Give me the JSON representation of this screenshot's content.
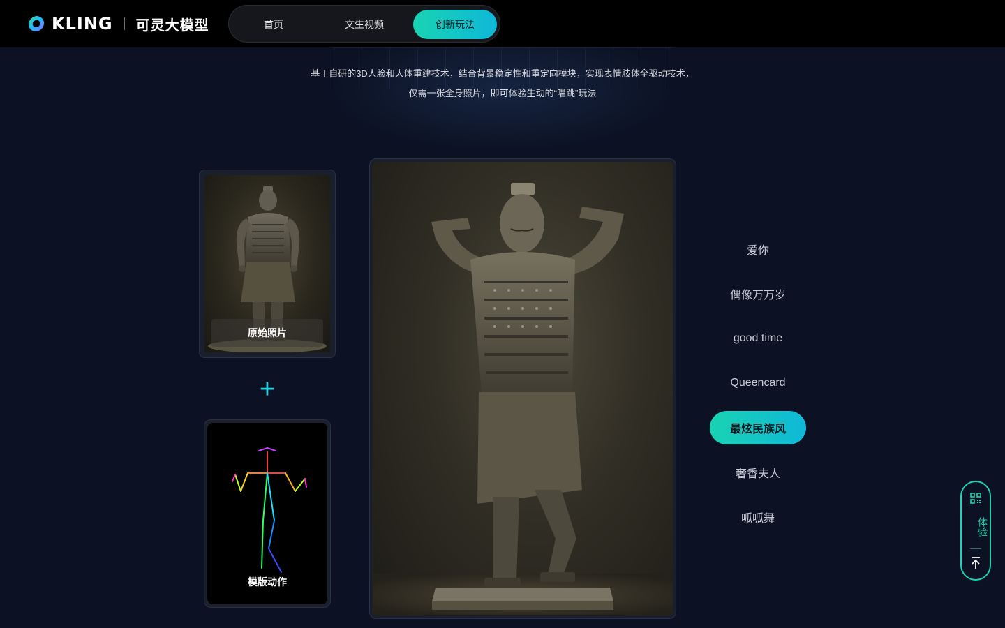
{
  "header": {
    "brand": "KLING",
    "brand_cn": "可灵大模型",
    "nav": [
      {
        "label": "首页",
        "active": false
      },
      {
        "label": "文生视频",
        "active": false
      },
      {
        "label": "创新玩法",
        "active": true
      }
    ]
  },
  "intro": {
    "line1": "基于自研的3D人脸和人体重建技术，结合背景稳定性和重定向模块，实现表情肢体全驱动技术，",
    "line2": "仅需一张全身照片，即可体验生动的“唱跳”玩法"
  },
  "cards": {
    "original_label": "原始照片",
    "plus_symbol": "+",
    "template_label": "模版动作"
  },
  "songs": [
    {
      "label": "爱你",
      "active": false
    },
    {
      "label": "偶像万万岁",
      "active": false
    },
    {
      "label": "good time",
      "active": false
    },
    {
      "label": "Queencard",
      "active": false
    },
    {
      "label": "最炫民族风",
      "active": true
    },
    {
      "label": "奢香夫人",
      "active": false
    },
    {
      "label": "呱呱舞",
      "active": false
    }
  ],
  "float": {
    "label": "体验",
    "qr_icon": "qr-code-icon",
    "top_icon": "back-to-top-icon"
  },
  "colors": {
    "accent_start": "#19d3b2",
    "accent_end": "#0fb8d8",
    "background": "#0c1224"
  }
}
